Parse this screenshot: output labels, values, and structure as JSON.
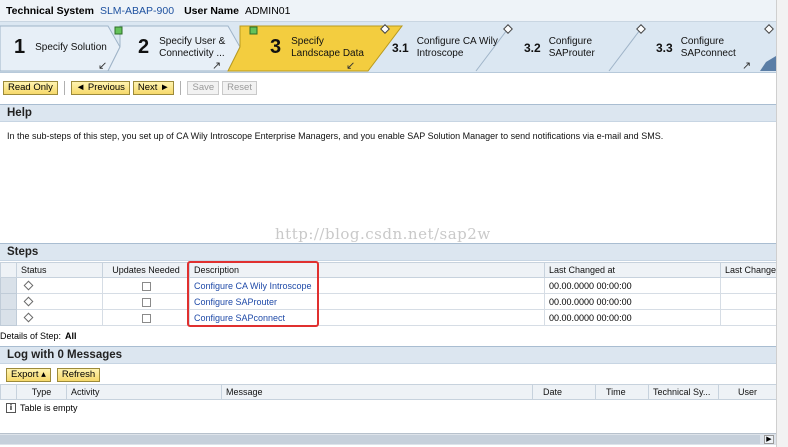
{
  "header": {
    "system_label": "Technical System",
    "system_value": "SLM-ABAP-900",
    "user_label": "User Name",
    "user_value": "ADMIN01"
  },
  "roadmap": {
    "steps": [
      {
        "number": "1",
        "line1": "Specify Solution",
        "line2": ""
      },
      {
        "number": "2",
        "line1": "Specify User &",
        "line2": "Connectivity ..."
      },
      {
        "number": "3",
        "line1": "Specify",
        "line2": "Landscape Data"
      }
    ],
    "substeps": [
      {
        "number": "3.1",
        "line1": "Configure CA Wily",
        "line2": "Introscope"
      },
      {
        "number": "3.2",
        "line1": "Configure",
        "line2": "SAProuter"
      },
      {
        "number": "3.3",
        "line1": "Configure",
        "line2": "SAPconnect"
      }
    ]
  },
  "toolbar": {
    "read_only": "Read Only",
    "previous": "◄ Previous",
    "next": "Next ►",
    "save": "Save",
    "reset": "Reset"
  },
  "help": {
    "title": "Help",
    "text": "In the sub-steps of this step, you set up of CA Wily Introscope Enterprise Managers, and you enable SAP Solution Manager to send notifications via e-mail and SMS."
  },
  "watermark": "http://blog.csdn.net/sap2w",
  "steps": {
    "title": "Steps",
    "columns": [
      "Status",
      "Updates Needed",
      "Description",
      "Last Changed at",
      "Last Changed"
    ],
    "rows": [
      {
        "description": "Configure CA Wily Introscope",
        "last_changed": "00.00.0000 00:00:00"
      },
      {
        "description": "Configure SAProuter",
        "last_changed": "00.00.0000 00:00:00"
      },
      {
        "description": "Configure SAPconnect",
        "last_changed": "00.00.0000 00:00:00"
      }
    ],
    "details_label": "Details of Step:",
    "details_value": "All"
  },
  "log": {
    "title": "Log with 0 Messages",
    "export_label": "Export ▴",
    "refresh_label": "Refresh",
    "columns": [
      "Type",
      "Activity",
      "Message",
      "Date",
      "Time",
      "Technical Sy...",
      "User"
    ],
    "empty_text": "Table is empty"
  }
}
